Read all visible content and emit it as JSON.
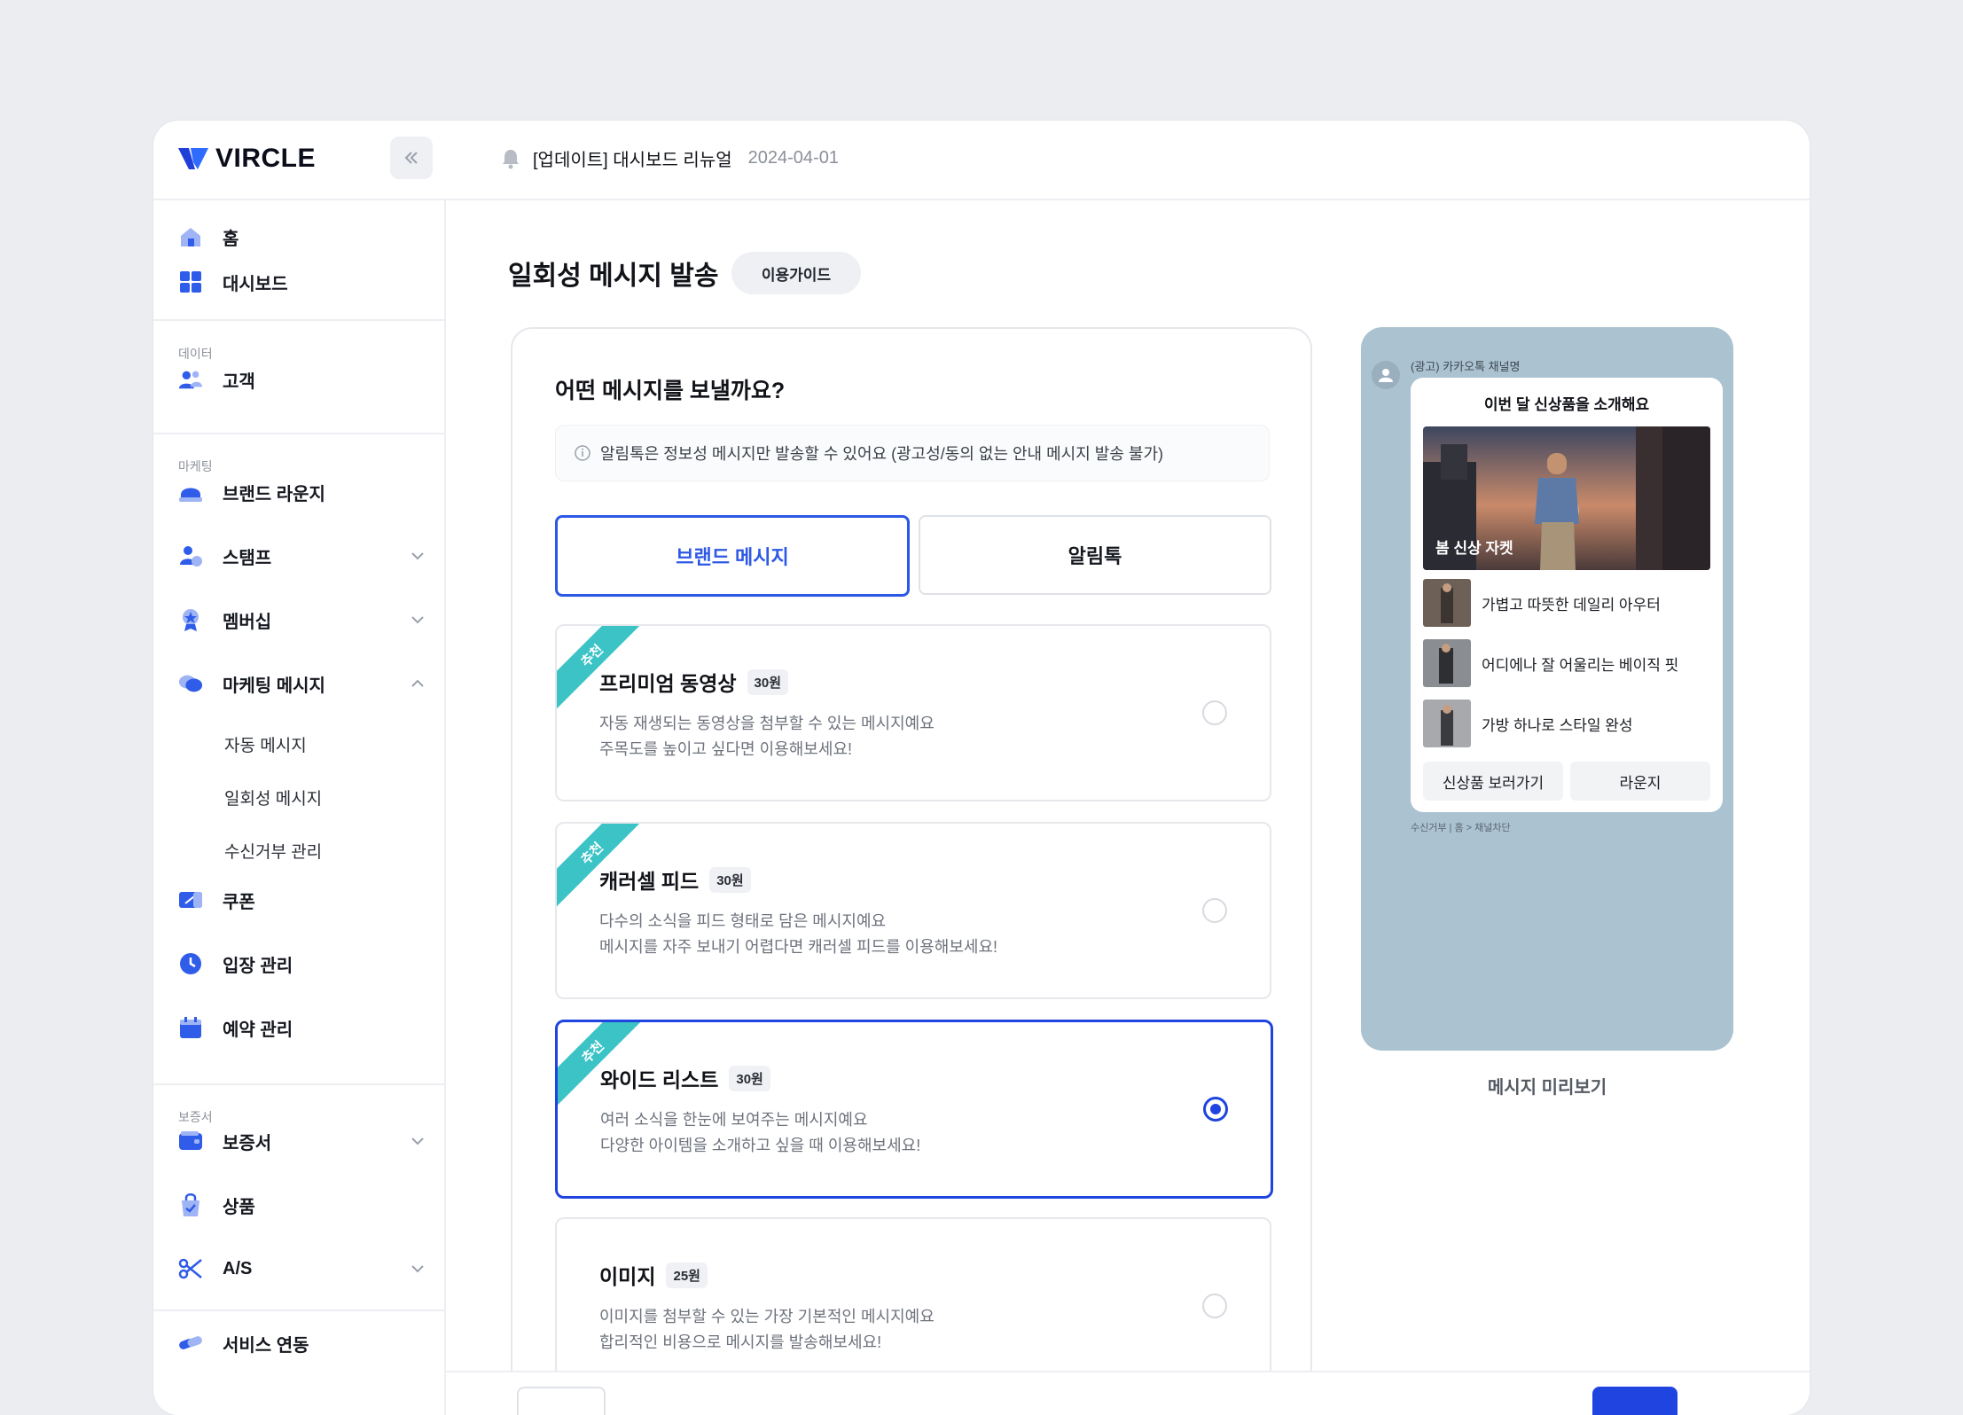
{
  "brand": {
    "name": "VIRCLE"
  },
  "notice": {
    "text": "[업데이트] 대시보드 리뉴얼",
    "date": "2024-04-01"
  },
  "sidebar": {
    "items": [
      {
        "label": "홈",
        "icon": "home-icon"
      },
      {
        "label": "대시보드",
        "icon": "dashboard-icon"
      }
    ],
    "sections": [
      {
        "label": "데이터",
        "items": [
          {
            "label": "고객",
            "icon": "customers-icon"
          }
        ]
      },
      {
        "label": "마케팅",
        "items": [
          {
            "label": "브랜드 라운지",
            "icon": "lounge-icon"
          },
          {
            "label": "스탬프",
            "icon": "stamp-icon",
            "expandable": true
          },
          {
            "label": "멤버십",
            "icon": "membership-icon",
            "expandable": true
          },
          {
            "label": "마케팅 메시지",
            "icon": "chat-icon",
            "expanded": true,
            "children": [
              {
                "label": "자동 메시지"
              },
              {
                "label": "일회성 메시지"
              },
              {
                "label": "수신거부 관리"
              }
            ]
          },
          {
            "label": "쿠폰",
            "icon": "coupon-icon"
          },
          {
            "label": "입장 관리",
            "icon": "clock-icon"
          },
          {
            "label": "예약 관리",
            "icon": "calendar-icon"
          }
        ]
      },
      {
        "label": "보증서",
        "items": [
          {
            "label": "보증서",
            "icon": "wallet-icon",
            "expandable": true
          },
          {
            "label": "상품",
            "icon": "bag-icon"
          },
          {
            "label": "A/S",
            "icon": "scissors-icon",
            "expandable": true
          }
        ]
      },
      {
        "label": "",
        "items": [
          {
            "label": "서비스 연동",
            "icon": "link-icon"
          }
        ]
      }
    ]
  },
  "main": {
    "title": "일회성 메시지 발송",
    "guide_label": "이용가이드",
    "question": "어떤 메시지를 보낼까요?",
    "info": "알림톡은 정보성 메시지만 발송할 수 있어요 (광고성/동의 없는 안내 메시지 발송 불가)",
    "tabs": [
      {
        "label": "브랜드 메시지",
        "active": true
      },
      {
        "label": "알림톡",
        "active": false
      }
    ],
    "ribbon_label": "추천",
    "cards": [
      {
        "title": "프리미엄 동영상",
        "price": "30원",
        "desc1": "자동 재생되는 동영상을 첨부할 수 있는 메시지예요",
        "desc2": "주목도를 높이고 싶다면 이용해보세요!",
        "recommended": true,
        "selected": false
      },
      {
        "title": "캐러셀 피드",
        "price": "30원",
        "desc1": "다수의 소식을 피드 형태로 담은 메시지예요",
        "desc2": "메시지를 자주 보내기 어렵다면 캐러셀 피드를 이용해보세요!",
        "recommended": true,
        "selected": false
      },
      {
        "title": "와이드 리스트",
        "price": "30원",
        "desc1": "여러 소식을 한눈에 보여주는 메시지예요",
        "desc2": "다양한 아이템을 소개하고 싶을 때 이용해보세요!",
        "recommended": true,
        "selected": true
      },
      {
        "title": "이미지",
        "price": "25원",
        "desc1": "이미지를 첨부할 수 있는 가장 기본적인 메시지예요",
        "desc2": "합리적인 비용으로 메시지를 발송해보세요!",
        "recommended": false,
        "selected": false
      }
    ]
  },
  "preview": {
    "channel": "(광고) 카카오톡 채널명",
    "headline": "이번 달 신상품을 소개해요",
    "hero_caption": "봄 신상 자켓",
    "items": [
      "가볍고 따뜻한 데일리 아우터",
      "어디에나 잘 어울리는 베이직 핏",
      "가방 하나로 스타일 완성"
    ],
    "buttons": [
      "신상품 보러가기",
      "라운지"
    ],
    "footer": "수신거부 | 홈 > 채널차단",
    "label": "메시지 미리보기"
  },
  "colors": {
    "accent": "#1f44e0",
    "ribbon": "#3cc3c6",
    "preview_bg": "#abc2d0"
  }
}
